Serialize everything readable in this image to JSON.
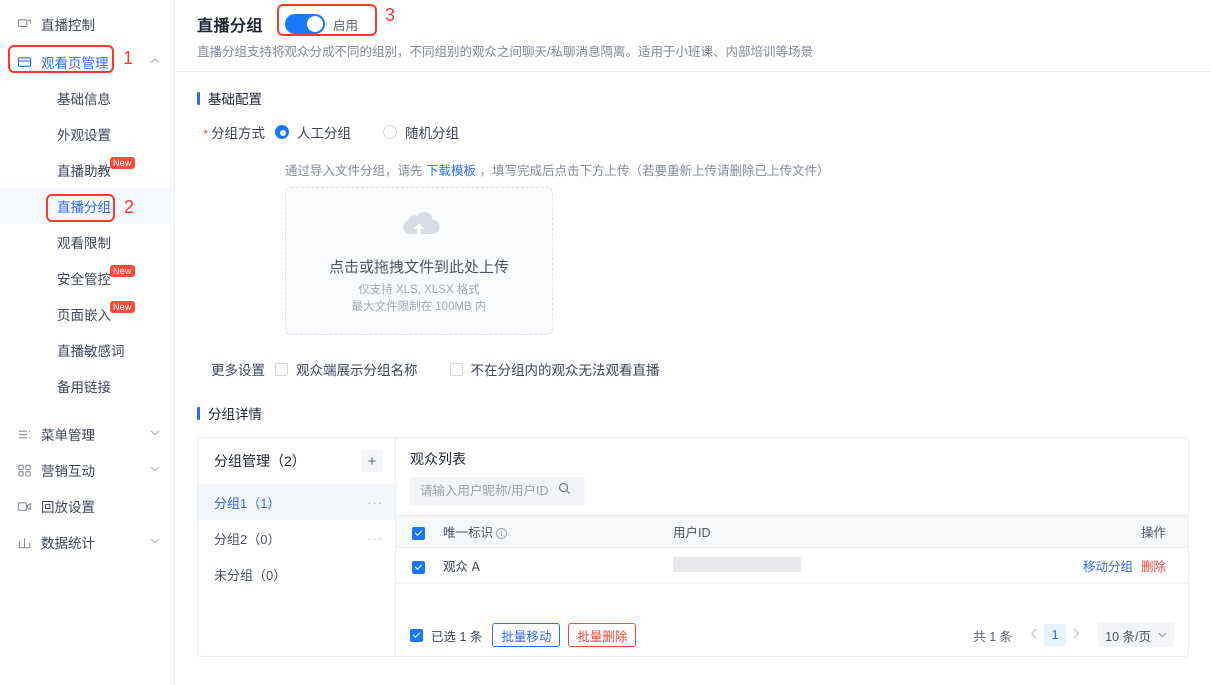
{
  "sidebar": {
    "top_items": [
      {
        "label": "直播控制",
        "icon": "screen-share-icon",
        "active": false,
        "expandable": false
      },
      {
        "label": "观看页管理",
        "icon": "monitor-icon",
        "active": true,
        "expandable": true
      }
    ],
    "sub_items": [
      {
        "label": "基础信息",
        "badge": "",
        "current": false
      },
      {
        "label": "外观设置",
        "badge": "",
        "current": false
      },
      {
        "label": "直播助教",
        "badge": "New",
        "current": false
      },
      {
        "label": "直播分组",
        "badge": "",
        "current": true
      },
      {
        "label": "观看限制",
        "badge": "",
        "current": false
      },
      {
        "label": "安全管控",
        "badge": "New",
        "current": false
      },
      {
        "label": "页面嵌入",
        "badge": "New",
        "current": false
      },
      {
        "label": "直播敏感词",
        "badge": "",
        "current": false
      },
      {
        "label": "备用链接",
        "badge": "",
        "current": false
      }
    ],
    "bottom_items": [
      {
        "label": "菜单管理",
        "icon": "menu-list-icon",
        "expandable": true
      },
      {
        "label": "营销互动",
        "icon": "grid-icon",
        "expandable": true
      },
      {
        "label": "回放设置",
        "icon": "video-icon",
        "expandable": false
      },
      {
        "label": "数据统计",
        "icon": "bar-chart-icon",
        "expandable": true
      }
    ]
  },
  "annotations": [
    {
      "number": "1",
      "target": "观看页管理"
    },
    {
      "number": "2",
      "target": "直播分组"
    },
    {
      "number": "3",
      "target": "启用开关"
    }
  ],
  "header": {
    "title": "直播分组",
    "switch_label": "启用",
    "switch_on": true,
    "description": "直播分组支持将观众分成不同的组别，不同组别的观众之间聊天/私聊消息隔离。适用于小班课、内部培训等场景"
  },
  "basic_config": {
    "section_title": "基础配置",
    "mode_label": "分组方式",
    "mode_required": "*",
    "options": [
      {
        "label": "人工分组",
        "checked": true
      },
      {
        "label": "随机分组",
        "checked": false
      }
    ],
    "hint_prefix": "通过导入文件分组，请先 ",
    "hint_link": "下载模板",
    "hint_suffix": " ，填写完成后点击下方上传（若要重新上传请删除已上传文件）",
    "uploader": {
      "icon": "cloud-upload-icon",
      "main_text": "点击或拖拽文件到此处上传",
      "sub_text_1": "仅支持 XLS, XLSX 格式",
      "sub_text_2": "最大文件限制在 100MB 内"
    },
    "more_label": "更多设置",
    "more_options": [
      {
        "label": "观众端展示分组名称",
        "checked": false
      },
      {
        "label": "不在分组内的观众无法观看直播",
        "checked": false
      }
    ]
  },
  "group_detail": {
    "section_title": "分组详情",
    "group_panel": {
      "title": "分组管理",
      "count": "（2）",
      "add_icon": "plus-icon",
      "groups": [
        {
          "name": "分组1",
          "count": "（1）",
          "active": true
        },
        {
          "name": "分组2",
          "count": "（0）",
          "active": false
        },
        {
          "name": "未分组",
          "count": "（0）",
          "active": false
        }
      ]
    },
    "viewer_panel": {
      "title": "观众列表",
      "search_placeholder": "请输入用户昵称/用户ID",
      "search_value": "",
      "search_icon": "search-icon",
      "columns": [
        "唯一标识",
        "用户ID",
        "操作"
      ],
      "unique_info_icon": "info-icon",
      "rows": [
        {
          "checked": true,
          "unique_id": "观众 A",
          "user_id": "",
          "user_id_redacted": true,
          "action_move": "移动分组",
          "action_delete": "删除"
        }
      ],
      "footer": {
        "select_all_checked": true,
        "selected_text": "已选 1 条",
        "batch_move": "批量移动",
        "batch_delete": "批量删除",
        "total_text": "共 1 条",
        "prev_icon": "chevron-left-icon",
        "current_page": "1",
        "next_icon": "chevron-right-icon",
        "page_size": "10 条/页"
      }
    }
  },
  "colors": {
    "accent": "#2b6cf6",
    "switch_on": "#1677ff",
    "danger": "#f5483b",
    "annotation": "#f83a2d",
    "badge_new": "#fb4a3a"
  }
}
